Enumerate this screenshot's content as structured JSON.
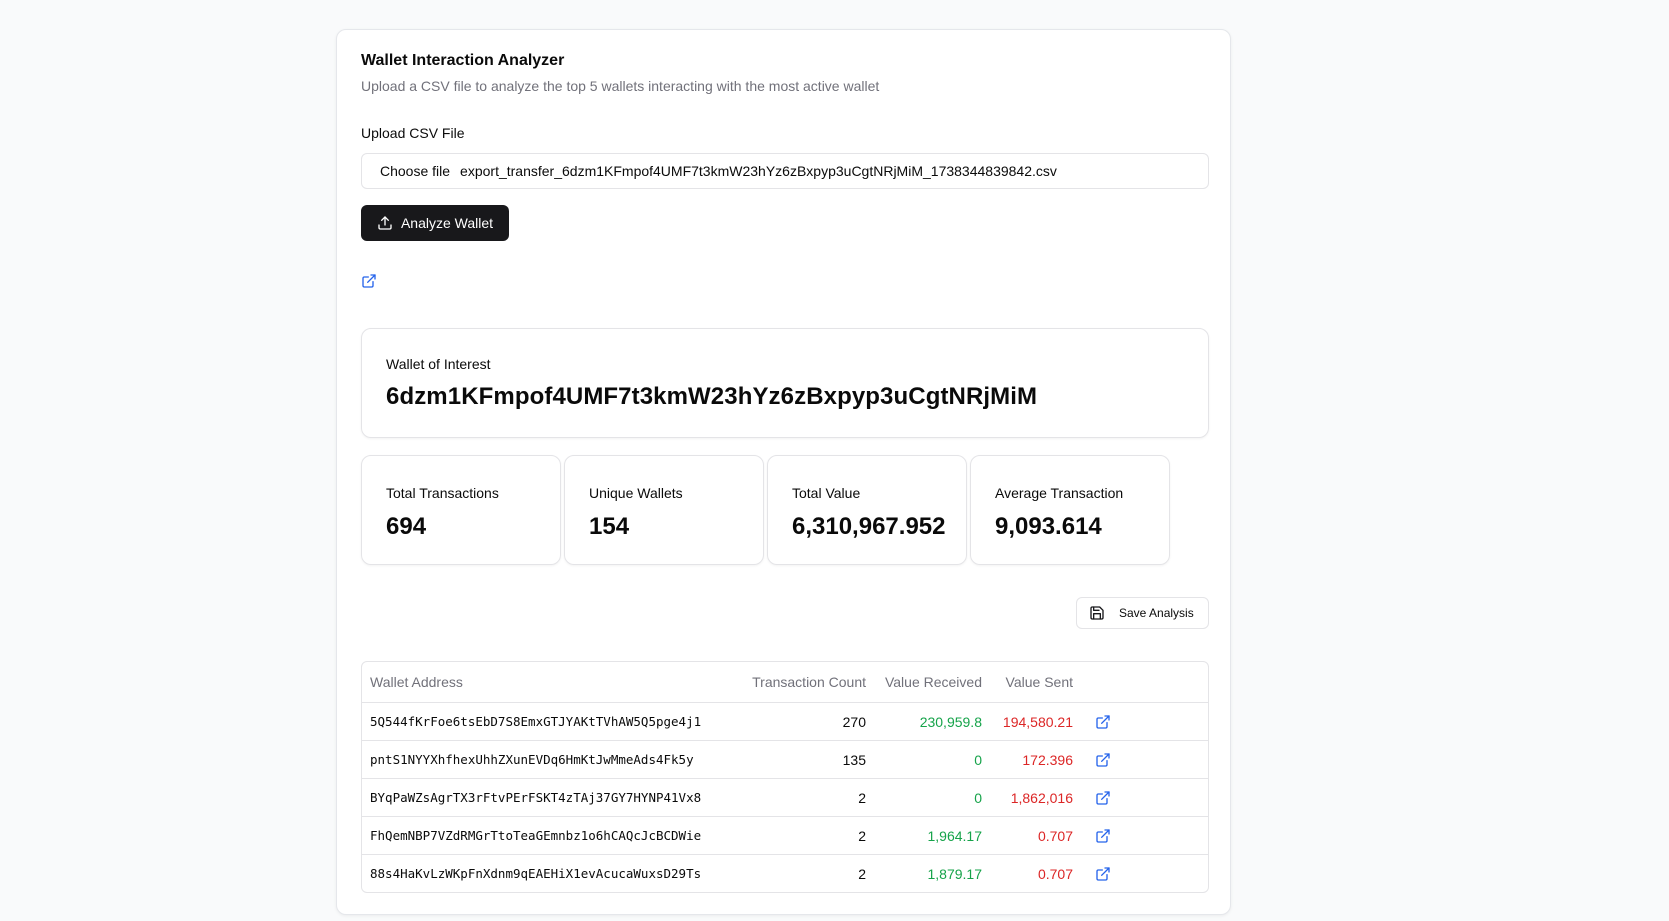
{
  "header": {
    "title": "Wallet Interaction Analyzer",
    "subtitle": "Upload a CSV file to analyze the top 5 wallets interacting with the most active wallet"
  },
  "upload": {
    "label": "Upload CSV File",
    "choose_label": "Choose file",
    "file_name": "export_transfer_6dzm1KFmpof4UMF7t3kmW23hYz6zBxpyp3uCgtNRjMiM_1738344839842.csv"
  },
  "analyze_button": {
    "label": "Analyze Wallet",
    "icon": "upload-icon"
  },
  "wallet_of_interest": {
    "label": "Wallet of Interest",
    "address": "6dzm1KFmpof4UMF7t3kmW23hYz6zBxpyp3uCgtNRjMiM"
  },
  "stats": [
    {
      "label": "Total Transactions",
      "value": "694"
    },
    {
      "label": "Unique Wallets",
      "value": "154"
    },
    {
      "label": "Total Value",
      "value": "6,310,967.952"
    },
    {
      "label": "Average Transaction",
      "value": "9,093.614"
    }
  ],
  "save_button": {
    "label": "Save Analysis",
    "icon": "save-icon"
  },
  "table": {
    "headers": [
      "Wallet Address",
      "Transaction Count",
      "Value Received",
      "Value Sent"
    ],
    "rows": [
      {
        "address": "5Q544fKrFoe6tsEbD7S8EmxGTJYAKtTVhAW5Q5pge4j1",
        "count": "270",
        "received": "230,959.8",
        "sent": "194,580.21"
      },
      {
        "address": "pntS1NYYXhfhexUhhZXunEVDq6HmKtJwMmeAds4Fk5y",
        "count": "135",
        "received": "0",
        "sent": "172.396"
      },
      {
        "address": "BYqPaWZsAgrTX3rFtvPErFSKT4zTAj37GY7HYNP41Vx8",
        "count": "2",
        "received": "0",
        "sent": "1,862,016"
      },
      {
        "address": "FhQemNBP7VZdRMGrTtoTeaGEmnbz1o6hCAQcJcBCDWie",
        "count": "2",
        "received": "1,964.17",
        "sent": "0.707"
      },
      {
        "address": "88s4HaKvLzWKpFnXdnm9qEAEHiX1evAcucaWuxsD29Ts",
        "count": "2",
        "received": "1,879.17",
        "sent": "0.707"
      }
    ]
  },
  "colors": {
    "positive": "#16a34a",
    "negative": "#dc2626",
    "link": "#2563eb",
    "primary_button": "#18181b"
  }
}
